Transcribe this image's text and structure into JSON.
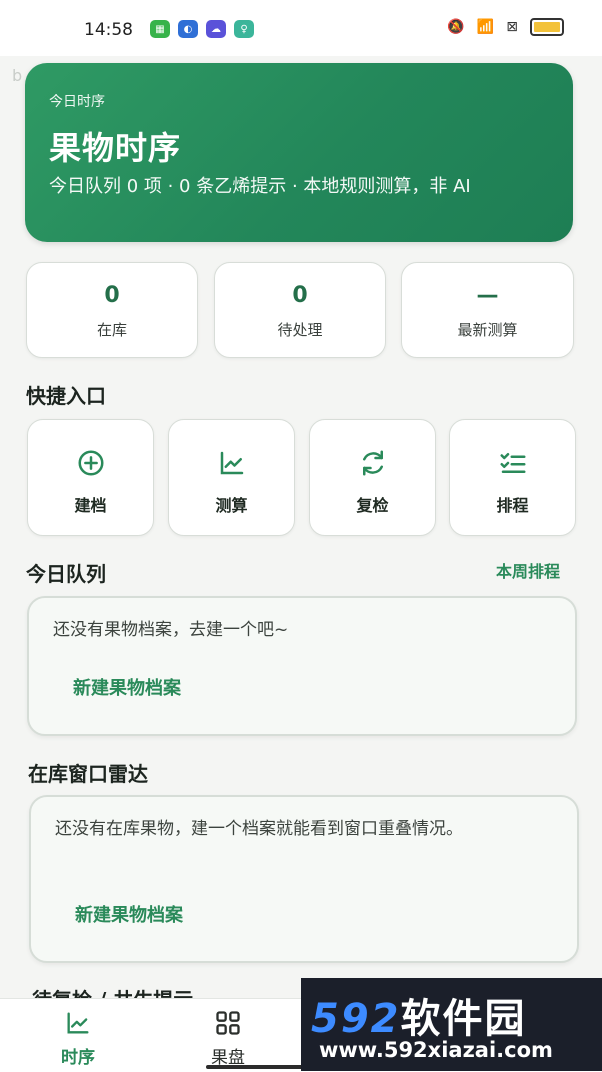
{
  "status_bar": {
    "time": "14:58"
  },
  "faint_char": "b",
  "hero": {
    "eyebrow": "今日时序",
    "title": "果物时序",
    "subtitle": "今日队列 0 项 · 0 条乙烯提示 · 本地规则测算，非 AI"
  },
  "stats": [
    {
      "value": "0",
      "label": "在库"
    },
    {
      "value": "0",
      "label": "待处理"
    },
    {
      "value": "—",
      "label": "最新测算"
    }
  ],
  "quick_entry": {
    "title": "快捷入口",
    "items": [
      {
        "label": "建档",
        "icon": "add-circle-icon"
      },
      {
        "label": "测算",
        "icon": "chart-line-icon"
      },
      {
        "label": "复检",
        "icon": "refresh-icon"
      },
      {
        "label": "排程",
        "icon": "checklist-icon"
      }
    ]
  },
  "today_queue": {
    "title": "今日队列",
    "link": "本周排程",
    "empty_text": "还没有果物档案，去建一个吧~",
    "action": "新建果物档案"
  },
  "radar": {
    "title": "在库窗口雷达",
    "empty_text": "还没有在库果物，建一个档案就能看到窗口重叠情况。",
    "action": "新建果物档案"
  },
  "next_section_peek": "待复检 / 共生提示",
  "bottom_nav": {
    "items": [
      {
        "label": "时序",
        "icon": "chart-line-icon",
        "active": true
      },
      {
        "label": "果盘",
        "icon": "grid-icon",
        "active": false
      }
    ]
  },
  "watermark": {
    "top_num": "592",
    "top_text": "软件园",
    "bottom": "www.592xiazai.com"
  },
  "colors": {
    "accent": "#2a8a5a",
    "hero_start": "#2f9a64",
    "hero_end": "#1e7e54"
  }
}
